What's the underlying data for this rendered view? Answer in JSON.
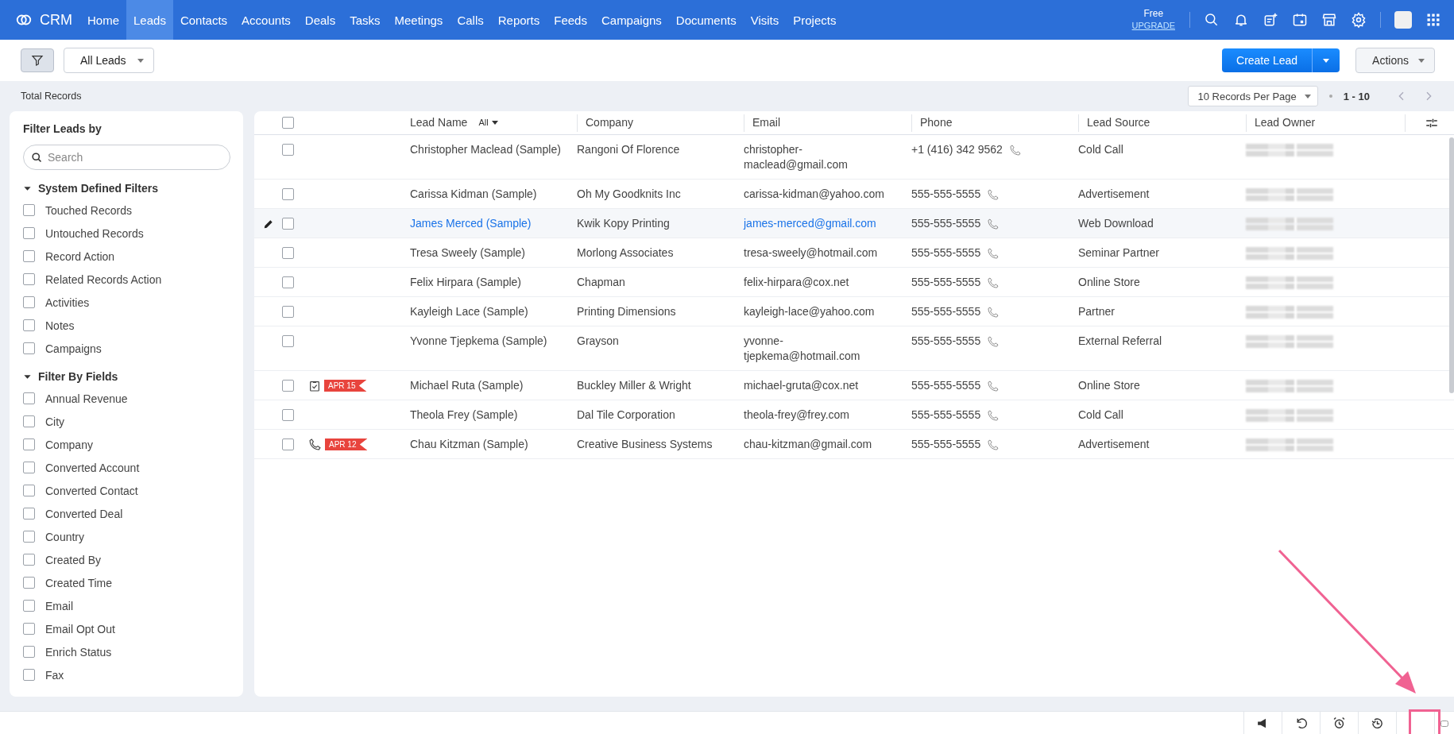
{
  "nav": {
    "brand": "CRM",
    "items": [
      {
        "label": "Home",
        "selected": false
      },
      {
        "label": "Leads",
        "selected": true
      },
      {
        "label": "Contacts",
        "selected": false
      },
      {
        "label": "Accounts",
        "selected": false
      },
      {
        "label": "Deals",
        "selected": false
      },
      {
        "label": "Tasks",
        "selected": false
      },
      {
        "label": "Meetings",
        "selected": false
      },
      {
        "label": "Calls",
        "selected": false
      },
      {
        "label": "Reports",
        "selected": false
      },
      {
        "label": "Feeds",
        "selected": false
      },
      {
        "label": "Campaigns",
        "selected": false
      },
      {
        "label": "Documents",
        "selected": false
      },
      {
        "label": "Visits",
        "selected": false
      },
      {
        "label": "Projects",
        "selected": false
      }
    ],
    "plan": "Free",
    "upgrade": "UPGRADE"
  },
  "toolbar": {
    "view": "All Leads",
    "create": "Create Lead",
    "actions": "Actions"
  },
  "summary": {
    "label": "Total Records",
    "per_page": "10 Records Per Page",
    "range": "1 - 10"
  },
  "sidebar": {
    "title": "Filter Leads by",
    "search": {
      "placeholder": "Search"
    },
    "groups": [
      {
        "title": "System Defined Filters",
        "expanded": true,
        "items": [
          {
            "label": "Touched Records",
            "checked": false
          },
          {
            "label": "Untouched Records",
            "checked": false
          },
          {
            "label": "Record Action",
            "checked": false
          },
          {
            "label": "Related Records Action",
            "checked": false
          },
          {
            "label": "Activities",
            "checked": false
          },
          {
            "label": "Notes",
            "checked": false
          },
          {
            "label": "Campaigns",
            "checked": false
          }
        ]
      },
      {
        "title": "Filter By Fields",
        "expanded": true,
        "items": [
          {
            "label": "Annual Revenue",
            "checked": false
          },
          {
            "label": "City",
            "checked": false
          },
          {
            "label": "Company",
            "checked": false
          },
          {
            "label": "Converted Account",
            "checked": false
          },
          {
            "label": "Converted Contact",
            "checked": false
          },
          {
            "label": "Converted Deal",
            "checked": false
          },
          {
            "label": "Country",
            "checked": false
          },
          {
            "label": "Created By",
            "checked": false
          },
          {
            "label": "Created Time",
            "checked": false
          },
          {
            "label": "Email",
            "checked": false
          },
          {
            "label": "Email Opt Out",
            "checked": false
          },
          {
            "label": "Enrich Status",
            "checked": false
          },
          {
            "label": "Fax",
            "checked": false
          }
        ]
      }
    ]
  },
  "table": {
    "columns": [
      "Lead Name",
      "Company",
      "Email",
      "Phone",
      "Lead Source",
      "Lead Owner"
    ],
    "name_filter": "All",
    "select_all": false,
    "rows": [
      {
        "checked": false,
        "hovered": false,
        "name": "Christopher Maclead (Sample)",
        "company": "Rangoni Of Florence",
        "email": "christopher-maclead@gmail.com",
        "phone": "+1 (416) 342 9562",
        "source": "Cold Call"
      },
      {
        "checked": false,
        "hovered": false,
        "name": "Carissa Kidman (Sample)",
        "company": "Oh My Goodknits Inc",
        "email": "carissa-kidman@yahoo.com",
        "phone": "555-555-5555",
        "source": "Advertisement"
      },
      {
        "checked": false,
        "hovered": true,
        "name": "James Merced (Sample)",
        "company": "Kwik Kopy Printing",
        "email": "james-merced@gmail.com",
        "phone": "555-555-5555",
        "source": "Web Download"
      },
      {
        "checked": false,
        "hovered": false,
        "name": "Tresa Sweely (Sample)",
        "company": "Morlong Associates",
        "email": "tresa-sweely@hotmail.com",
        "phone": "555-555-5555",
        "source": "Seminar Partner"
      },
      {
        "checked": false,
        "hovered": false,
        "name": "Felix Hirpara (Sample)",
        "company": "Chapman",
        "email": "felix-hirpara@cox.net",
        "phone": "555-555-5555",
        "source": "Online Store"
      },
      {
        "checked": false,
        "hovered": false,
        "name": "Kayleigh Lace (Sample)",
        "company": "Printing Dimensions",
        "email": "kayleigh-lace@yahoo.com",
        "phone": "555-555-5555",
        "source": "Partner"
      },
      {
        "checked": false,
        "hovered": false,
        "name": "Yvonne Tjepkema (Sample)",
        "company": "Grayson",
        "email": "yvonne-tjepkema@hotmail.com",
        "phone": "555-555-5555",
        "source": "External Referral"
      },
      {
        "checked": false,
        "hovered": false,
        "activity": {
          "kind": "task",
          "date": "APR 15"
        },
        "name": "Michael Ruta (Sample)",
        "company": "Buckley Miller & Wright",
        "email": "michael-gruta@cox.net",
        "phone": "555-555-5555",
        "source": "Online Store"
      },
      {
        "checked": false,
        "hovered": false,
        "name": "Theola Frey (Sample)",
        "company": "Dal Tile Corporation",
        "email": "theola-frey@frey.com",
        "phone": "555-555-5555",
        "source": "Cold Call"
      },
      {
        "checked": false,
        "hovered": false,
        "activity": {
          "kind": "call",
          "date": "APR 12"
        },
        "name": "Chau Kitzman (Sample)",
        "company": "Creative Business Systems",
        "email": "chau-kitzman@gmail.com",
        "phone": "555-555-5555",
        "source": "Advertisement"
      }
    ]
  }
}
